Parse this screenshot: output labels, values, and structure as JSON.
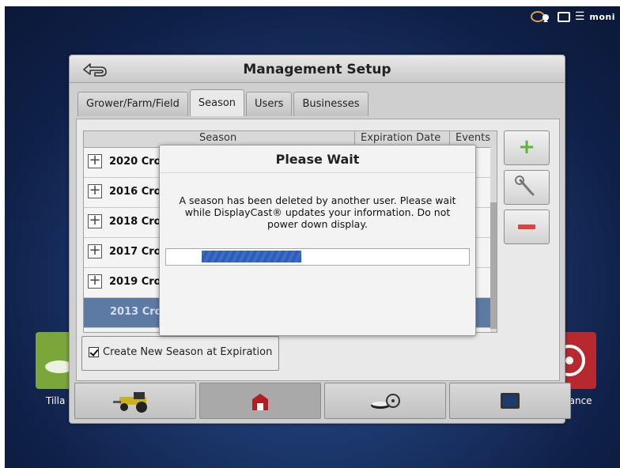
{
  "status": {
    "icons": [
      "satellite-icon",
      "display-icon",
      "cellular-icon"
    ],
    "cell_label": "moni"
  },
  "tiles": {
    "left_label": "Tilla",
    "right_label": "dance"
  },
  "window": {
    "title": "Management Setup",
    "tabs": [
      {
        "label": "Grower/Farm/Field",
        "active": false
      },
      {
        "label": "Season",
        "active": true
      },
      {
        "label": "Users",
        "active": false
      },
      {
        "label": "Businesses",
        "active": false
      }
    ]
  },
  "table": {
    "headers": {
      "season": "Season",
      "expiration": "Expiration Date",
      "events": "Events"
    },
    "rows": [
      {
        "label": "2020 Cro",
        "expand": "+"
      },
      {
        "label": "2016 Cro",
        "expand": "+"
      },
      {
        "label": "2018 Cro",
        "expand": "+"
      },
      {
        "label": "2017 Cro",
        "expand": "+"
      },
      {
        "label": "2019 Cro",
        "expand": "+"
      },
      {
        "label": "2013 Cro",
        "selected": true
      }
    ]
  },
  "side_buttons": {
    "add": "+",
    "edit": "🔧",
    "remove": "—"
  },
  "checkbox": {
    "label": "Create New Season at Expiration",
    "checked": true
  },
  "bottom_bar": [
    "tractor-icon",
    "barn-icon",
    "steering-icon",
    "display-icon"
  ],
  "modal": {
    "title": "Please Wait",
    "message_line1": "A season has been deleted by another user. Please wait",
    "message_line2": "while DisplayCast® updates your information. Do not",
    "message_line3": "power down display.",
    "progress": 0.33
  },
  "colors": {
    "selected_row": "#5d7aa3",
    "progress": "#3a6dc9",
    "add_green": "#6cc04a",
    "remove_red": "#d6463e"
  }
}
